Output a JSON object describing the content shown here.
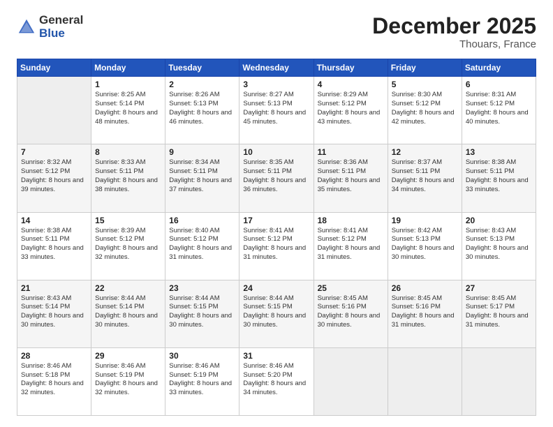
{
  "header": {
    "logo_general": "General",
    "logo_blue": "Blue",
    "title": "December 2025",
    "subtitle": "Thouars, France"
  },
  "days_of_week": [
    "Sunday",
    "Monday",
    "Tuesday",
    "Wednesday",
    "Thursday",
    "Friday",
    "Saturday"
  ],
  "weeks": [
    [
      {
        "day": null,
        "sunrise": null,
        "sunset": null,
        "daylight": null
      },
      {
        "day": "1",
        "sunrise": "Sunrise: 8:25 AM",
        "sunset": "Sunset: 5:14 PM",
        "daylight": "Daylight: 8 hours and 48 minutes."
      },
      {
        "day": "2",
        "sunrise": "Sunrise: 8:26 AM",
        "sunset": "Sunset: 5:13 PM",
        "daylight": "Daylight: 8 hours and 46 minutes."
      },
      {
        "day": "3",
        "sunrise": "Sunrise: 8:27 AM",
        "sunset": "Sunset: 5:13 PM",
        "daylight": "Daylight: 8 hours and 45 minutes."
      },
      {
        "day": "4",
        "sunrise": "Sunrise: 8:29 AM",
        "sunset": "Sunset: 5:12 PM",
        "daylight": "Daylight: 8 hours and 43 minutes."
      },
      {
        "day": "5",
        "sunrise": "Sunrise: 8:30 AM",
        "sunset": "Sunset: 5:12 PM",
        "daylight": "Daylight: 8 hours and 42 minutes."
      },
      {
        "day": "6",
        "sunrise": "Sunrise: 8:31 AM",
        "sunset": "Sunset: 5:12 PM",
        "daylight": "Daylight: 8 hours and 40 minutes."
      }
    ],
    [
      {
        "day": "7",
        "sunrise": "Sunrise: 8:32 AM",
        "sunset": "Sunset: 5:12 PM",
        "daylight": "Daylight: 8 hours and 39 minutes."
      },
      {
        "day": "8",
        "sunrise": "Sunrise: 8:33 AM",
        "sunset": "Sunset: 5:11 PM",
        "daylight": "Daylight: 8 hours and 38 minutes."
      },
      {
        "day": "9",
        "sunrise": "Sunrise: 8:34 AM",
        "sunset": "Sunset: 5:11 PM",
        "daylight": "Daylight: 8 hours and 37 minutes."
      },
      {
        "day": "10",
        "sunrise": "Sunrise: 8:35 AM",
        "sunset": "Sunset: 5:11 PM",
        "daylight": "Daylight: 8 hours and 36 minutes."
      },
      {
        "day": "11",
        "sunrise": "Sunrise: 8:36 AM",
        "sunset": "Sunset: 5:11 PM",
        "daylight": "Daylight: 8 hours and 35 minutes."
      },
      {
        "day": "12",
        "sunrise": "Sunrise: 8:37 AM",
        "sunset": "Sunset: 5:11 PM",
        "daylight": "Daylight: 8 hours and 34 minutes."
      },
      {
        "day": "13",
        "sunrise": "Sunrise: 8:38 AM",
        "sunset": "Sunset: 5:11 PM",
        "daylight": "Daylight: 8 hours and 33 minutes."
      }
    ],
    [
      {
        "day": "14",
        "sunrise": "Sunrise: 8:38 AM",
        "sunset": "Sunset: 5:11 PM",
        "daylight": "Daylight: 8 hours and 33 minutes."
      },
      {
        "day": "15",
        "sunrise": "Sunrise: 8:39 AM",
        "sunset": "Sunset: 5:12 PM",
        "daylight": "Daylight: 8 hours and 32 minutes."
      },
      {
        "day": "16",
        "sunrise": "Sunrise: 8:40 AM",
        "sunset": "Sunset: 5:12 PM",
        "daylight": "Daylight: 8 hours and 31 minutes."
      },
      {
        "day": "17",
        "sunrise": "Sunrise: 8:41 AM",
        "sunset": "Sunset: 5:12 PM",
        "daylight": "Daylight: 8 hours and 31 minutes."
      },
      {
        "day": "18",
        "sunrise": "Sunrise: 8:41 AM",
        "sunset": "Sunset: 5:12 PM",
        "daylight": "Daylight: 8 hours and 31 minutes."
      },
      {
        "day": "19",
        "sunrise": "Sunrise: 8:42 AM",
        "sunset": "Sunset: 5:13 PM",
        "daylight": "Daylight: 8 hours and 30 minutes."
      },
      {
        "day": "20",
        "sunrise": "Sunrise: 8:43 AM",
        "sunset": "Sunset: 5:13 PM",
        "daylight": "Daylight: 8 hours and 30 minutes."
      }
    ],
    [
      {
        "day": "21",
        "sunrise": "Sunrise: 8:43 AM",
        "sunset": "Sunset: 5:14 PM",
        "daylight": "Daylight: 8 hours and 30 minutes."
      },
      {
        "day": "22",
        "sunrise": "Sunrise: 8:44 AM",
        "sunset": "Sunset: 5:14 PM",
        "daylight": "Daylight: 8 hours and 30 minutes."
      },
      {
        "day": "23",
        "sunrise": "Sunrise: 8:44 AM",
        "sunset": "Sunset: 5:15 PM",
        "daylight": "Daylight: 8 hours and 30 minutes."
      },
      {
        "day": "24",
        "sunrise": "Sunrise: 8:44 AM",
        "sunset": "Sunset: 5:15 PM",
        "daylight": "Daylight: 8 hours and 30 minutes."
      },
      {
        "day": "25",
        "sunrise": "Sunrise: 8:45 AM",
        "sunset": "Sunset: 5:16 PM",
        "daylight": "Daylight: 8 hours and 30 minutes."
      },
      {
        "day": "26",
        "sunrise": "Sunrise: 8:45 AM",
        "sunset": "Sunset: 5:16 PM",
        "daylight": "Daylight: 8 hours and 31 minutes."
      },
      {
        "day": "27",
        "sunrise": "Sunrise: 8:45 AM",
        "sunset": "Sunset: 5:17 PM",
        "daylight": "Daylight: 8 hours and 31 minutes."
      }
    ],
    [
      {
        "day": "28",
        "sunrise": "Sunrise: 8:46 AM",
        "sunset": "Sunset: 5:18 PM",
        "daylight": "Daylight: 8 hours and 32 minutes."
      },
      {
        "day": "29",
        "sunrise": "Sunrise: 8:46 AM",
        "sunset": "Sunset: 5:19 PM",
        "daylight": "Daylight: 8 hours and 32 minutes."
      },
      {
        "day": "30",
        "sunrise": "Sunrise: 8:46 AM",
        "sunset": "Sunset: 5:19 PM",
        "daylight": "Daylight: 8 hours and 33 minutes."
      },
      {
        "day": "31",
        "sunrise": "Sunrise: 8:46 AM",
        "sunset": "Sunset: 5:20 PM",
        "daylight": "Daylight: 8 hours and 34 minutes."
      },
      {
        "day": null,
        "sunrise": null,
        "sunset": null,
        "daylight": null
      },
      {
        "day": null,
        "sunrise": null,
        "sunset": null,
        "daylight": null
      },
      {
        "day": null,
        "sunrise": null,
        "sunset": null,
        "daylight": null
      }
    ]
  ]
}
